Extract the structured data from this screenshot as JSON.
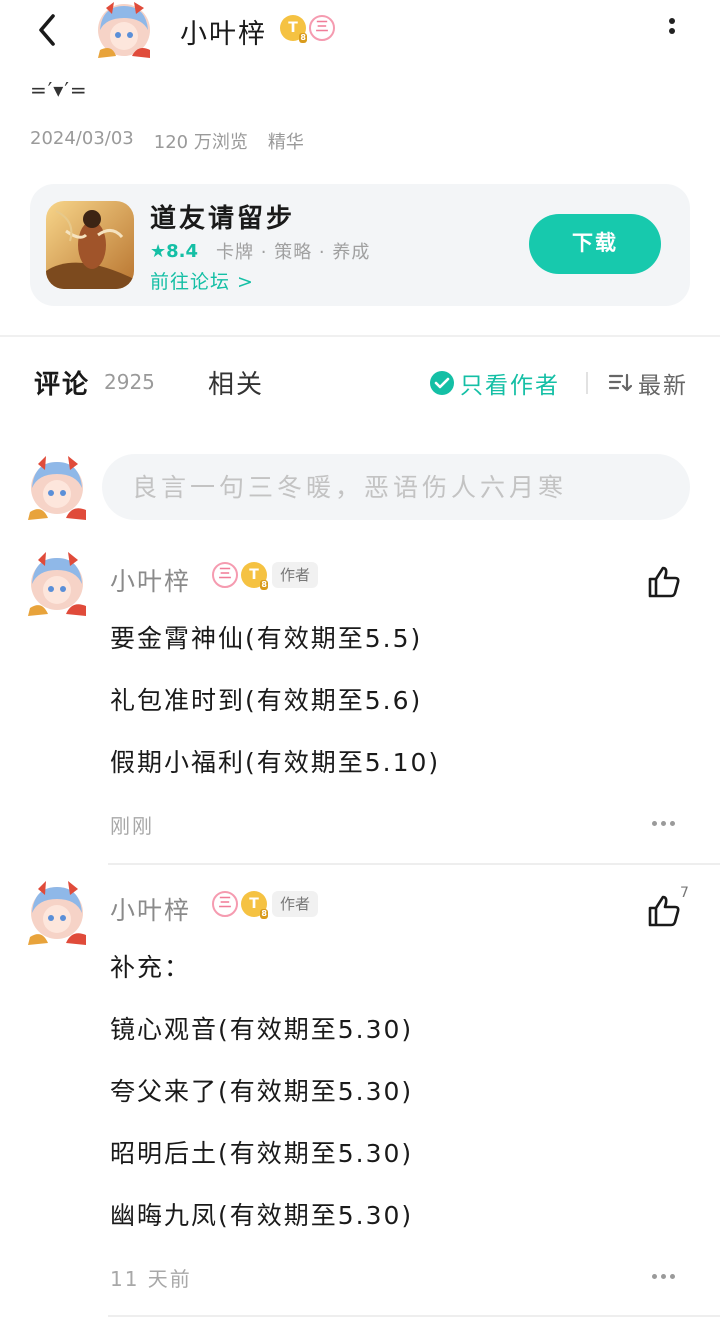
{
  "header": {
    "author_name": "小叶梓",
    "coin_badge": "T",
    "coin_badge_sub": "8",
    "level_badge": "三"
  },
  "post": {
    "title": "=′▾′=",
    "date": "2024/03/03",
    "views": "120 万浏览",
    "tag": "精华"
  },
  "game": {
    "name": "道友请留步",
    "score": "★8.4",
    "tags": "卡牌 · 策略 · 养成",
    "forum_link": "前往论坛 >",
    "download_label": "下载"
  },
  "tabs": {
    "comments_label": "评论",
    "comments_count": "2925",
    "related_label": "相关",
    "author_only_label": "只看作者",
    "sort_label": "最新"
  },
  "comment_input": {
    "placeholder": "良言一句三冬暖，恶语伤人六月寒"
  },
  "comments": [
    {
      "name": "小叶梓",
      "level_badge": "三",
      "coin_badge": "T",
      "coin_badge_sub": "8",
      "author_tag": "作者",
      "lines": [
        "要金霄神仙(有效期至5.5)",
        "礼包准时到(有效期至5.6)",
        "假期小福利(有效期至5.10)"
      ],
      "time": "刚刚",
      "likes": ""
    },
    {
      "name": "小叶梓",
      "level_badge": "三",
      "coin_badge": "T",
      "coin_badge_sub": "8",
      "author_tag": "作者",
      "lines": [
        "补充：",
        "镜心观音(有效期至5.30)",
        "夸父来了(有效期至5.30)",
        "昭明后土(有效期至5.30)",
        "幽晦九凤(有效期至5.30)"
      ],
      "time": "11 天前",
      "likes": "7"
    }
  ],
  "colors": {
    "accent": "#17c9ad",
    "card_bg": "#f3f5f7",
    "muted_text": "#9a9a9a"
  },
  "icons": {
    "back": "chevron-left-icon",
    "more": "more-vertical-icon",
    "check": "check-circle-icon",
    "sort": "sort-lines-icon",
    "like": "thumbs-up-icon",
    "comment_more": "more-horizontal-icon"
  }
}
